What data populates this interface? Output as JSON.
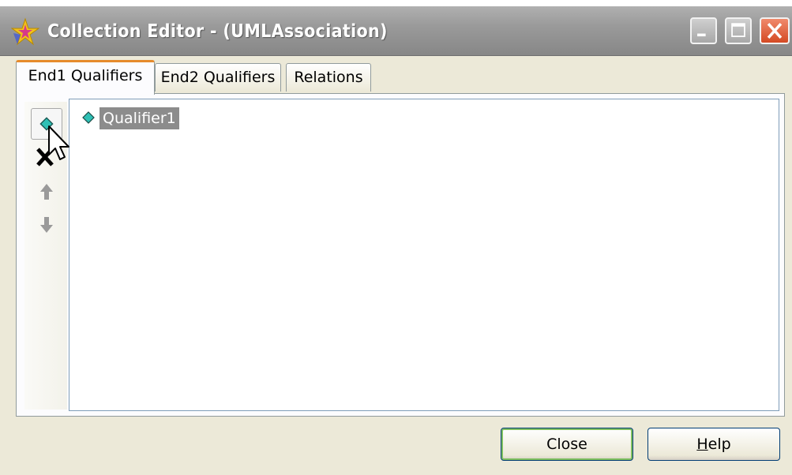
{
  "window": {
    "title": "Collection Editor - (UMLAssociation)",
    "icon": "star-icon",
    "controls": [
      "minimize-icon",
      "maximize-icon",
      "close-icon"
    ]
  },
  "tabs": [
    {
      "label": "End1 Qualifiers",
      "active": true
    },
    {
      "label": "End2 Qualifiers",
      "active": false
    },
    {
      "label": "Relations",
      "active": false
    }
  ],
  "toolbar": {
    "items": [
      "add-icon",
      "delete-icon",
      "move-up-icon",
      "move-down-icon"
    ]
  },
  "list": {
    "items": [
      {
        "label": "Qualifier1",
        "icon": "diamond-icon",
        "selected": true
      }
    ]
  },
  "buttons": {
    "close": {
      "label": "Close",
      "underline": ""
    },
    "help": {
      "label": "Help",
      "underline": "H",
      "rest": "elp"
    }
  },
  "colors": {
    "tab_active_accent": "#e68b2c",
    "selection": "#8c8c8c",
    "diamond": "#2fc0b5",
    "close_button": "#d44a24"
  }
}
